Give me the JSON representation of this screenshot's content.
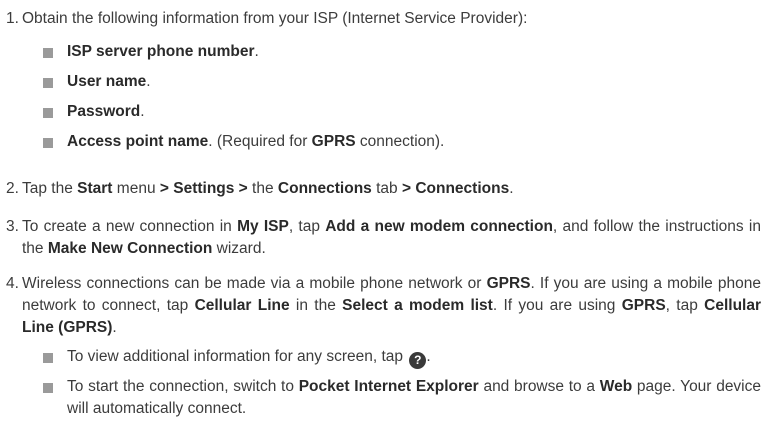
{
  "steps": [
    {
      "num": "1.",
      "parts": [
        "Obtain the following information from your ISP (Internet Service Provider):"
      ]
    },
    {
      "num": "2.",
      "parts": [
        "Tap the ",
        "Start",
        " menu ",
        "> Settings >",
        " the ",
        "Connections",
        " tab ",
        "> Connections",
        "."
      ]
    },
    {
      "num": "3.",
      "parts": [
        "To create a new connection in ",
        "My ISP",
        ", tap ",
        "Add a new modem connection",
        ", and follow the instructions in the ",
        "Make New Connection",
        " wizard."
      ]
    },
    {
      "num": "4.",
      "parts": [
        "Wireless connections can be made via a mobile phone network or ",
        "GPRS",
        ". If you are using a mobile phone network to connect, tap ",
        "Cellular Line",
        " in the ",
        "Select a modem list",
        ". If you are using ",
        "GPRS",
        ", tap ",
        "Cellular Line (GPRS)",
        "."
      ]
    }
  ],
  "step1_items": [
    {
      "bold": "ISP server phone number",
      "rest": "."
    },
    {
      "bold": "User name",
      "rest": "."
    },
    {
      "bold": "Password",
      "rest": "."
    },
    {
      "bold": "Access point name",
      "rest": ". (Required for ",
      "bold2": "GPRS",
      "rest2": " connection)."
    }
  ],
  "step4_items": [
    {
      "text": "To view additional information for any screen, tap ",
      "icon": "help-icon",
      "icon_glyph": "?",
      "after": "."
    },
    {
      "parts": [
        "To start the connection, switch to ",
        "Pocket Internet Explorer",
        " and browse to a ",
        "Web",
        " page. Your device will automatically connect."
      ]
    }
  ]
}
